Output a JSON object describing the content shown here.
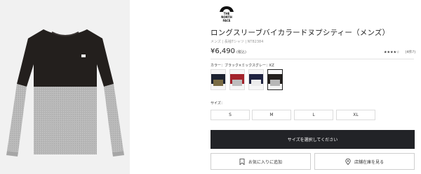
{
  "brand": {
    "logo_text_1": "THE",
    "logo_text_2": "NORTH",
    "logo_text_3": "FACE"
  },
  "product": {
    "title": "ロングスリーブバイカラードヌプシティー（メンズ）",
    "subtitle": "メンズ | 長袖Tシャツ | NT82384",
    "price": "¥6,490",
    "tax_note": "(税込)",
    "rating_stars": "★★★★☆",
    "rating_count": "(4件?)"
  },
  "color": {
    "label": "カラー：ブラック×ミックスグレー：KZ",
    "swatches": [
      {
        "name": "navy-khaki",
        "top": "#1c2230",
        "bottom": "#7a6c45"
      },
      {
        "name": "red-grey",
        "top": "#a3232b",
        "bottom": "#bdbdbd"
      },
      {
        "name": "navy-white",
        "top": "#1f2340",
        "bottom": "#f2f2f2"
      },
      {
        "name": "black-grey",
        "top": "#221e1c",
        "bottom": "#b7b7b7"
      }
    ],
    "selected_index": 3
  },
  "size": {
    "label": "サイズ：",
    "options": [
      "S",
      "M",
      "L",
      "XL"
    ]
  },
  "actions": {
    "select_size": "サイズを選択してください",
    "favorite": "お気に入りに追加",
    "store_stock": "店舗在庫を見る"
  },
  "colors": {
    "cta_bg": "#222327",
    "shirt_black": "#231f1d",
    "shirt_grey": "#b9b9b9"
  }
}
